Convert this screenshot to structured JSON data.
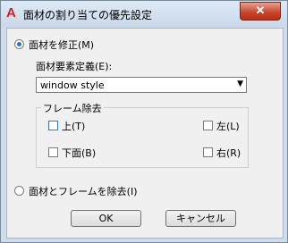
{
  "window": {
    "title": "面材の割り当ての優先設定",
    "close_glyph": "✕",
    "app_glyph": "A"
  },
  "options": {
    "modify_label": "面材を修正(M)",
    "modify_selected": true,
    "definition_label": "面材要素定義(E):",
    "definition_value": "window style",
    "remove_label": "面材とフレームを除去(I)",
    "remove_selected": false
  },
  "frame_remove": {
    "title": "フレーム除去",
    "top": "上(T)",
    "bottom": "下面(B)",
    "left": "左(L)",
    "right": "右(R)"
  },
  "buttons": {
    "ok": "OK",
    "cancel": "キャンセル"
  }
}
